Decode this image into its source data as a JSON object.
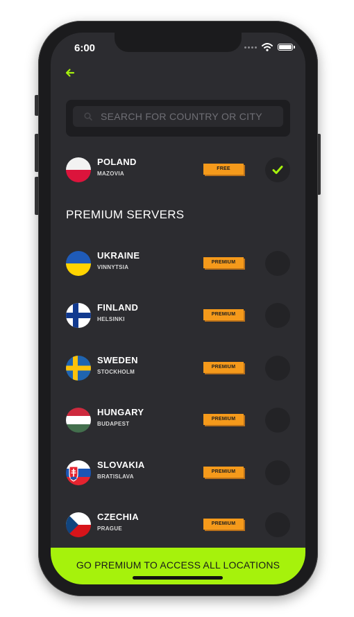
{
  "status_bar": {
    "time": "6:00"
  },
  "search": {
    "placeholder": "SEARCH FOR COUNTRY OR CITY"
  },
  "current_server": {
    "country": "POLAND",
    "city": "MAZOVIA",
    "badge": "FREE",
    "selected": true
  },
  "premium_section": {
    "title": "PREMIUM SERVERS"
  },
  "premium_servers": [
    {
      "country": "UKRAINE",
      "city": "VINNYTSIA",
      "badge": "PREMIUM"
    },
    {
      "country": "FINLAND",
      "city": "HELSINKI",
      "badge": "PREMIUM"
    },
    {
      "country": "SWEDEN",
      "city": "STOCKHOLM",
      "badge": "PREMIUM"
    },
    {
      "country": "HUNGARY",
      "city": "BUDAPEST",
      "badge": "PREMIUM"
    },
    {
      "country": "SLOVAKIA",
      "city": "BRATISLAVA",
      "badge": "PREMIUM"
    },
    {
      "country": "CZECHIA",
      "city": "PRAGUE",
      "badge": "PREMIUM"
    }
  ],
  "cta": {
    "label": "GO PREMIUM TO ACCESS ALL LOCATIONS"
  },
  "colors": {
    "accent": "#a6f20c",
    "badge": "#f59a1b",
    "background": "#2c2c30"
  }
}
